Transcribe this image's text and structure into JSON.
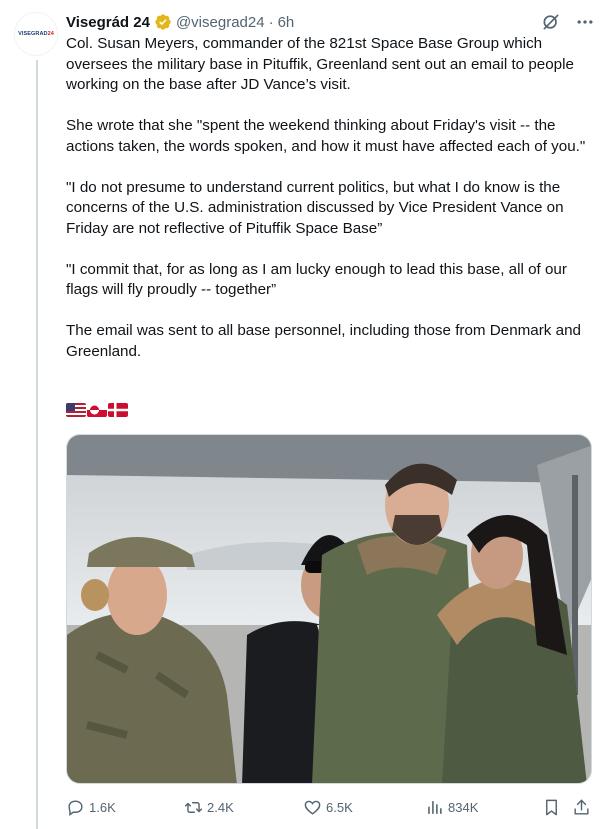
{
  "avatar": {
    "text_a": "VISEGRAD",
    "text_b": "24"
  },
  "author": {
    "name": "Visegrád 24",
    "handle": "@visegrad24",
    "separator": "·",
    "time": "6h"
  },
  "icons": {
    "verified": "verified-badge-icon",
    "grok": "grok-icon",
    "more": "more-icon"
  },
  "tweet": {
    "text": "Col. Susan Meyers, commander of the 821st Space Base Group which oversees the military base in Pituffik, Greenland sent out an email to people working on the base after JD Vance’s visit.\n\nShe wrote that she \"spent the weekend thinking about Friday's visit -- the actions taken, the words spoken, and how it must have affected each of you.\"\n\n\"I do not presume to understand current politics, but what I do know is the concerns of the U.S. administration discussed by Vice President Vance on Friday are not reflective of Pituffik Space Base”\n\n\"I commit that, for as long as I am lucky enough to lead this base, all of our flags will fly proudly -- together”\n\nThe email was sent to all base personnel, including those from Denmark and Greenland.",
    "flags": [
      "us-flag",
      "greenland-flag",
      "denmark-flag"
    ]
  },
  "actions": {
    "replies": "1.6K",
    "reposts": "2.4K",
    "likes": "6.5K",
    "views": "834K"
  },
  "colors": {
    "text": "#0f1419",
    "muted": "#536471",
    "verified_gold": "#e2b719",
    "divider": "#cfd9de"
  }
}
